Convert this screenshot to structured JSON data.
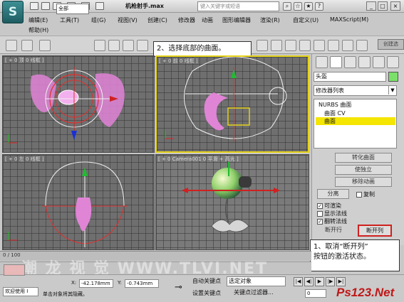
{
  "titlebar": {
    "title": "机枪射手.max",
    "search_placeholder": "键入关键字或短语"
  },
  "menu": {
    "items": [
      "编辑(E)",
      "工具(T)",
      "组(G)",
      "视图(V)",
      "创建(C)",
      "修改器",
      "动画",
      "图形编辑器",
      "渲染(R)",
      "自定义(U)",
      "MAXScript(M)",
      "帮助(H)"
    ]
  },
  "toolbar": {
    "selection_filter": "全部",
    "create_selection": "创建选"
  },
  "callouts": {
    "step2": "2、选择底部的曲面。",
    "step1_line1": "1、取消“断开列”",
    "step1_line2": "按钮的激活状态。"
  },
  "viewports": {
    "top": "[ + 0 顶 0 线框 ]",
    "front": "[ + 0 前 0 线框 ]",
    "left": "[ + 0 左 0 线框 ]",
    "perspective": "[ + 0 Camera001 0 平滑 + 高光 ]"
  },
  "command_panel": {
    "object_name": "头盔",
    "modifier_list": "修改器列表",
    "stack": [
      "NURBS 曲面",
      "曲面 CV",
      "曲面"
    ],
    "rollout_buttons": [
      "转化曲面",
      "使独立",
      "移除动画"
    ],
    "split_label": "分离",
    "copy_label": "复制",
    "renderable_label": "可渲染",
    "show_normals_label": "显示法线",
    "flip_normals_label": "翻转法线",
    "detach_row_label": "断开行",
    "detach_col_label": "断开列"
  },
  "timeline": {
    "frame_label": "0 / 100"
  },
  "status": {
    "welcome": "欢迎使用 I",
    "message": "单击对象将其隐藏。",
    "x_label": "X:",
    "x_value": "-42.178mm",
    "y_label": "Y:",
    "y_value": "-0.743mm",
    "autokey": "自动关键点",
    "setkey": "设置关键点",
    "selected_object": "选定对象",
    "key_filter": "关键点过滤器...",
    "frame_value": "0",
    "watermark": "潮 龙 视 觉  WWW.TLVI.NET",
    "brand": "Ps123.Net"
  },
  "colors": {
    "active_viewport": "#e6d21a",
    "highlight": "#d02020",
    "selection": "#f4e600",
    "surface": "#e084d6"
  }
}
